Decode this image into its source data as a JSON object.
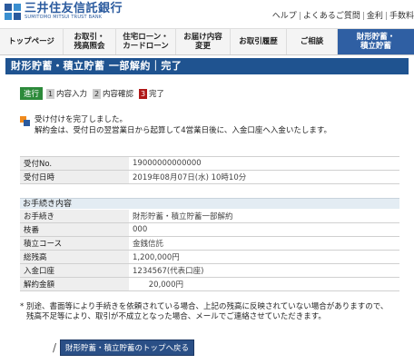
{
  "brand": {
    "name": "三井住友信託銀行",
    "sub": "SUMITOMO MITSUI TRUST BANK",
    "color": "#2a5a9e"
  },
  "util_links": [
    "ヘルプ",
    "よくあるご質問",
    "金利",
    "手数料"
  ],
  "nav": [
    {
      "label_1": "トップページ",
      "label_2": "",
      "active": false
    },
    {
      "label_1": "お取引・",
      "label_2": "残高照会",
      "active": false
    },
    {
      "label_1": "住宅ローン・",
      "label_2": "カードローン",
      "active": false
    },
    {
      "label_1": "お届け内容",
      "label_2": "変更",
      "active": false
    },
    {
      "label_1": "お取引履歴",
      "label_2": "",
      "active": false
    },
    {
      "label_1": "ご相談",
      "label_2": "",
      "active": false
    },
    {
      "label_1": "財形貯蓄・",
      "label_2": "積立貯蓄",
      "active": true
    }
  ],
  "title": "財形貯蓄・積立貯蓄 一部解約｜完了",
  "steps": {
    "current_label": "進行",
    "items": [
      {
        "num": "1",
        "label": "内容入力"
      },
      {
        "num": "2",
        "label": "内容確認"
      },
      {
        "num": "3",
        "label": "完了"
      }
    ]
  },
  "message": {
    "line1": "受け付けを完了しました。",
    "line2": "解約金は、受付日の翌営業日から起算して4営業日後に、入金口座へ入金いたします。"
  },
  "receipt": [
    {
      "key": "受付No.",
      "value": "19000000000000"
    },
    {
      "key": "受付日時",
      "value": "2019年08月07日(水) 10時10分"
    }
  ],
  "procedure_header": "お手続き内容",
  "procedure": [
    {
      "key": "お手続き",
      "value": "財形貯蓄・積立貯蓄一部解約"
    },
    {
      "key": "枝番",
      "value": "000"
    },
    {
      "key": "積立コース",
      "value": "金銭信託"
    },
    {
      "key": "総残高",
      "value": "1,200,000円"
    },
    {
      "key": "入金口座",
      "value": "1234567(代表口座)"
    },
    {
      "key": "解約金額",
      "value": "20,000円"
    }
  ],
  "notes": {
    "line1": "* 別途、書面等により手続きを依頼されている場合、上記の残高に反映されていない場合がありますので、",
    "line2": "残高不足等により、取引が不成立となった場合、メールでご連絡させていただきます。"
  },
  "back_button": "財形貯蓄・積立貯蓄のトップへ戻る",
  "colors": {
    "title_bar": "#1f5390",
    "nav_active": "#2f5fa3",
    "step_current": "#2c8a3a",
    "step_done": "#b01818"
  }
}
